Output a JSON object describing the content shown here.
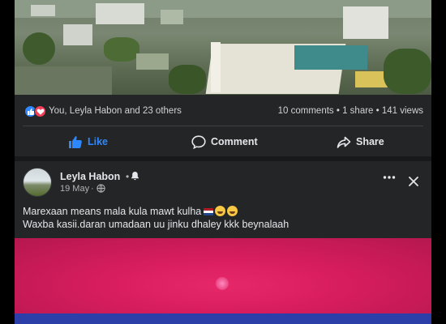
{
  "reactions": {
    "summary": "You, Leyla Habon and 23 others",
    "stats": "10 comments • 1 share • 141 views"
  },
  "actions": {
    "like": "Like",
    "comment": "Comment",
    "share": "Share"
  },
  "post": {
    "author": "Leyla Habon",
    "separator": "•",
    "date": "19 May",
    "date_separator": "·",
    "line1": "Marexaan means mala kula mawt kulha",
    "line2": "Waxba kasii.daran umadaan uu jinku dhaley kkk beynalaah"
  },
  "colors": {
    "accent": "#2d88ff",
    "love": "#f33e58",
    "background": "#242526"
  }
}
